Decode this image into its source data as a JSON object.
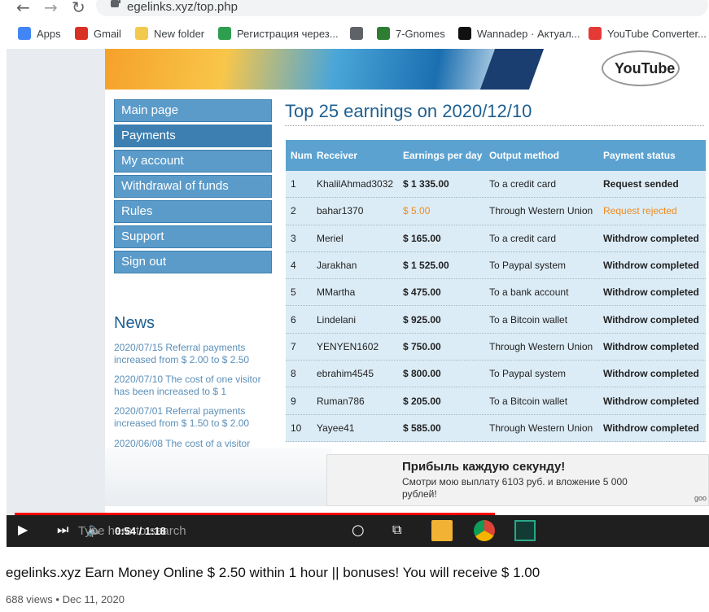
{
  "browser": {
    "url": "egelinks.xyz/top.php",
    "bookmarks": [
      {
        "label": "Apps",
        "icon": "apps-grid-icon",
        "color": "#4285f4"
      },
      {
        "label": "Gmail",
        "icon": "gmail-icon",
        "color": "#d93025"
      },
      {
        "label": "New folder",
        "icon": "folder-icon",
        "color": "#f2c94c"
      },
      {
        "label": "Регистрация через...",
        "icon": "ruble-icon",
        "color": "#2e9e4f"
      },
      {
        "label": "",
        "icon": "globe-icon",
        "color": "#5f6368"
      },
      {
        "label": "7-Gnomes",
        "icon": "gnome-icon",
        "color": "#2e7d32"
      },
      {
        "label": "Wannadep · Актуал...",
        "icon": "wd-icon",
        "color": "#111111"
      },
      {
        "label": "YouTube Converter...",
        "icon": "download-icon",
        "color": "#e53935"
      }
    ]
  },
  "site": {
    "banner_logo": "YouTube",
    "menu": [
      {
        "label": "Main page",
        "active": false
      },
      {
        "label": "Payments",
        "active": true
      },
      {
        "label": "My account",
        "active": false
      },
      {
        "label": "Withdrawal of funds",
        "active": false
      },
      {
        "label": "Rules",
        "active": false
      },
      {
        "label": "Support",
        "active": false
      },
      {
        "label": "Sign out",
        "active": false
      }
    ],
    "news_title": "News",
    "news": [
      "2020/07/15 Referral payments increased from $ 2.00 to $ 2.50",
      "2020/07/10 The cost of one visitor has been increased to $ 1",
      "2020/07/01 Referral payments increased from $ 1.50 to $ 2.00",
      "2020/06/08 The cost of a visitor"
    ],
    "title": "Top 25 earnings on 2020/12/10",
    "table": {
      "headers": [
        "Num",
        "Receiver",
        "Earnings per day",
        "Output method",
        "Payment status"
      ],
      "rows": [
        [
          "1",
          "KhalilAhmad3032",
          "$ 1 335.00",
          "To a credit card",
          "Request sended"
        ],
        [
          "2",
          "bahar1370",
          "$ 5.00",
          "Through Western Union",
          "Request rejected"
        ],
        [
          "3",
          "Meriel",
          "$ 165.00",
          "To a credit card",
          "Withdrow completed"
        ],
        [
          "4",
          "Jarakhan",
          "$ 1 525.00",
          "To Paypal system",
          "Withdrow completed"
        ],
        [
          "5",
          "MMartha",
          "$ 475.00",
          "To a bank account",
          "Withdrow completed"
        ],
        [
          "6",
          "Lindelani",
          "$ 925.00",
          "To a Bitcoin wallet",
          "Withdrow completed"
        ],
        [
          "7",
          "YENYEN1602",
          "$ 750.00",
          "Through Western Union",
          "Withdrow completed"
        ],
        [
          "8",
          "ebrahim4545",
          "$ 800.00",
          "To Paypal system",
          "Withdrow completed"
        ],
        [
          "9",
          "Ruman786",
          "$ 205.00",
          "To a Bitcoin wallet",
          "Withdrow completed"
        ],
        [
          "10",
          "Yayee41",
          "$ 585.00",
          "Through Western Union",
          "Withdrow completed"
        ]
      ],
      "highlight_row": 1,
      "highlight_color": "#f08a1c"
    }
  },
  "ad": {
    "title": "Прибыль каждую секунду!",
    "text": "Смотри мою выплату 6103 руб. и вложение 5 000 рублей!",
    "corner": "goo"
  },
  "player": {
    "time": "0:54 / 1:18",
    "search_ghost": "Type here to search",
    "progress": 0.692,
    "progress_color": "#ff0000"
  },
  "video": {
    "title": "egelinks.xyz Earn Money Online $ 2.50 within 1 hour || bonuses! You will receive $ 1.00",
    "meta": "688 views • Dec 11, 2020"
  }
}
